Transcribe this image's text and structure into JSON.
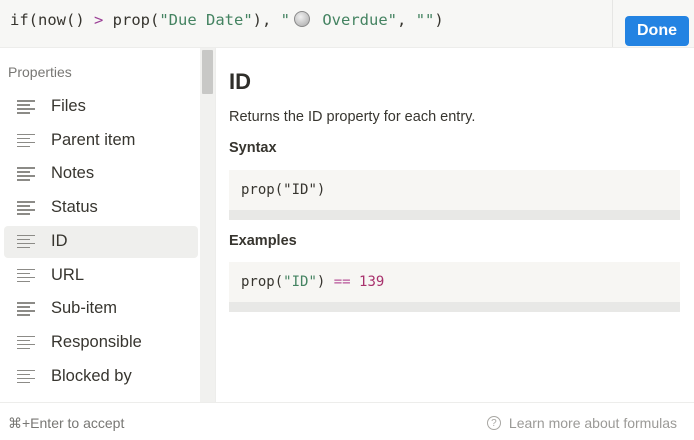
{
  "editor": {
    "formula_prefix": "if(now() ",
    "formula_op": ">",
    "formula_mid": " prop(",
    "formula_str1": "\"Due Date\"",
    "formula_comma": "), ",
    "formula_str2_open": "\"",
    "formula_emoji": "stopwatch-emoji",
    "formula_str2_text": " Overdue\"",
    "formula_rest": ", ",
    "formula_str3": "\"\"",
    "formula_close": ")",
    "done_label": "Done"
  },
  "sidebar": {
    "heading": "Properties",
    "items": [
      {
        "label": "Files",
        "icon": "text-property-icon"
      },
      {
        "label": "Parent item",
        "icon": "text-property-icon"
      },
      {
        "label": "Notes",
        "icon": "text-property-icon"
      },
      {
        "label": "Status",
        "icon": "text-property-icon"
      },
      {
        "label": "ID",
        "icon": "text-property-icon",
        "active": true
      },
      {
        "label": "URL",
        "icon": "text-property-icon"
      },
      {
        "label": "Sub-item",
        "icon": "text-property-icon"
      },
      {
        "label": "Responsible",
        "icon": "text-property-icon"
      },
      {
        "label": "Blocked by",
        "icon": "text-property-icon"
      }
    ]
  },
  "doc": {
    "title": "ID",
    "description": "Returns the ID property for each entry.",
    "syntax_heading": "Syntax",
    "syntax_code": {
      "fn": "prop(",
      "arg": "\"ID\"",
      "close": ")"
    },
    "examples_heading": "Examples",
    "example_code": {
      "fn": "prop(",
      "arg": "\"ID\"",
      "close": ") ",
      "op": "==",
      "num": " 139"
    }
  },
  "footer": {
    "hint": "⌘+Enter to accept",
    "learn_more": "Learn more about formulas",
    "help_icon": "?"
  },
  "colors": {
    "accent": "#2383e2",
    "string": "#448361",
    "operator": "#b8569a",
    "number": "#a8316c"
  }
}
